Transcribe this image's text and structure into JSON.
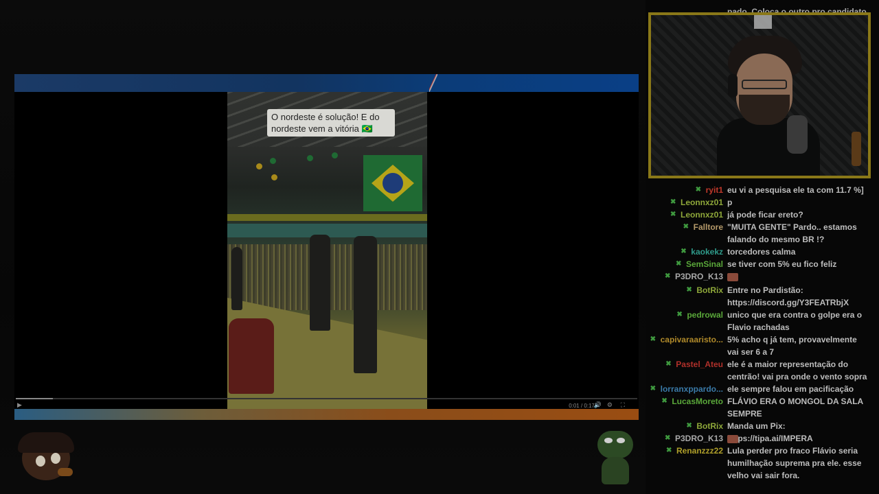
{
  "player": {
    "caption": "O nordeste é solução! E do nordeste vem a vitória 🇧🇷",
    "time": "0:01 / 0:17",
    "controls": {
      "play_glyph": "▶",
      "mute_glyph": "🔊",
      "settings_glyph": "⚙",
      "fullscreen_glyph": "⛶"
    },
    "progress_fraction": 0.06
  },
  "chat": {
    "overflow_text": "pado. Coloca o outro pro candidato",
    "messages": [
      {
        "user": "ryit1",
        "color": "#c0392b",
        "text": "eu vi a pesquisa ele ta com 11.7 %]"
      },
      {
        "user": "Leonnxz01",
        "color": "#8fa83a",
        "text": "p"
      },
      {
        "user": "Leonnxz01",
        "color": "#8fa83a",
        "text": "já pode ficar ereto?"
      },
      {
        "user": "Falltore",
        "color": "#b59a6a",
        "text": "\"MUITA GENTE\" Pardo.. estamos falando do mesmo BR !?"
      },
      {
        "user": "kaokekz",
        "color": "#2f9a8a",
        "text": "torcedores calma"
      },
      {
        "user": "SemSinal",
        "color": "#5aa83a",
        "text": "se tiver com 5% eu fico feliz"
      },
      {
        "user": "P3DRO_K13",
        "color": "#a9a9a9",
        "text": ""
      },
      {
        "user": "BotRix",
        "color": "#8fa83a",
        "text": "Entre no Pardistão: https://discord.gg/Y3FEATRbjX"
      },
      {
        "user": "pedrowal",
        "color": "#5aa83a",
        "text": "unico que era contra o golpe era o Flavio rachadas"
      },
      {
        "user": "capivaraaristo...",
        "color": "#b08a2a",
        "text": "5% acho q já tem, provavelmente vai ser 6 a 7"
      },
      {
        "user": "Pastel_Ateu",
        "color": "#b0302a",
        "text": "ele é a maior representação do centrão! vai pra onde o vento sopra"
      },
      {
        "user": "lorranxppardo...",
        "color": "#3a7aa8",
        "text": "ele sempre falou em pacificação"
      },
      {
        "user": "LucasMoreto",
        "color": "#5aa83a",
        "text": "FLÁVIO ERA O MONGOL DA SALA SEMPRE"
      },
      {
        "user": "BotRix",
        "color": "#8fa83a",
        "text": "Manda um Pix: https://tipa.ai/IMPERA"
      },
      {
        "user": "P3DRO_K13",
        "color": "#a9a9a9",
        "text": ""
      },
      {
        "user": "Renanzzz22",
        "color": "#b0a02a",
        "text": "Lula perder pro fraco Flávio seria humilhação suprema pra ele. esse velho vai sair fora."
      }
    ]
  },
  "colors": {
    "webcam_border": "#8a7818",
    "badge_green": "#3f9a3f",
    "banner_orange": "#9a4d12"
  }
}
